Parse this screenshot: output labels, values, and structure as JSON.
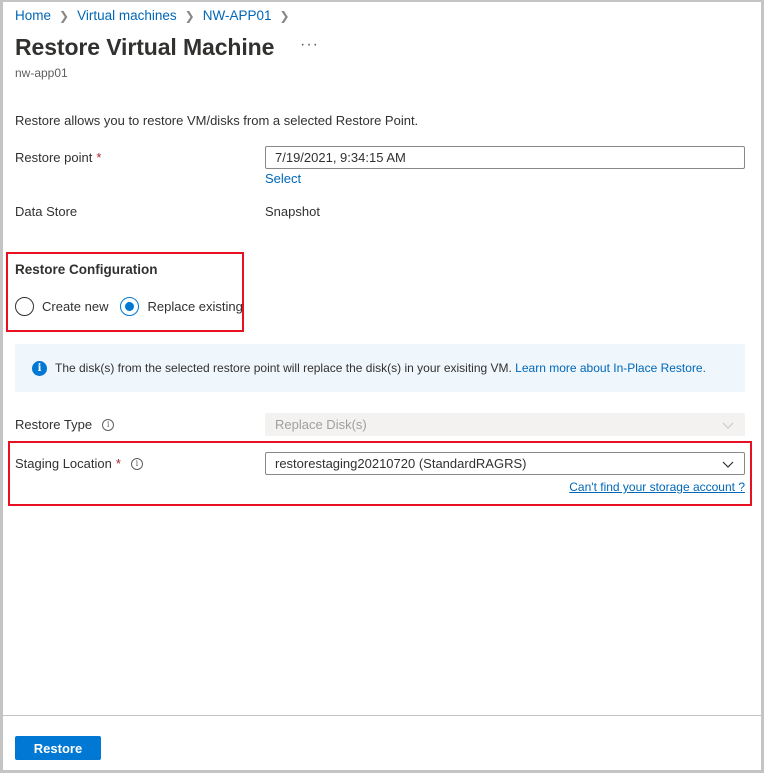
{
  "breadcrumb": [
    {
      "label": "Home"
    },
    {
      "label": "Virtual machines"
    },
    {
      "label": "NW-APP01"
    }
  ],
  "header": {
    "title": "Restore Virtual Machine",
    "more_label": "···",
    "subtitle": "nw-app01"
  },
  "intro": "Restore allows you to restore VM/disks from a selected Restore Point.",
  "restore_point": {
    "label": "Restore point",
    "required_mark": "*",
    "value": "7/19/2021, 9:34:15 AM",
    "select_link": "Select"
  },
  "data_store": {
    "label": "Data Store",
    "value": "Snapshot"
  },
  "restore_configuration": {
    "heading": "Restore Configuration",
    "options": [
      {
        "label": "Create new",
        "checked": false
      },
      {
        "label": "Replace existing",
        "checked": true
      }
    ]
  },
  "info_bar": {
    "icon": "info-icon",
    "text": "The disk(s) from the selected restore point will replace the disk(s) in your exisiting VM. ",
    "link": "Learn more about In-Place Restore."
  },
  "restore_type": {
    "label": "Restore Type",
    "info_icon": "i",
    "value": "Replace Disk(s)",
    "disabled": true
  },
  "staging_location": {
    "label": "Staging Location",
    "required_mark": "*",
    "info_icon": "i",
    "value": "restorestaging20210720 (StandardRAGRS)",
    "help_link": "Can't find your storage account ?"
  },
  "footer": {
    "restore_button": "Restore"
  },
  "colors": {
    "accent": "#0078d4",
    "link": "#0067b8",
    "highlight_box": "#e81123",
    "required": "#a4262c",
    "info_bg": "#eff6fc"
  }
}
